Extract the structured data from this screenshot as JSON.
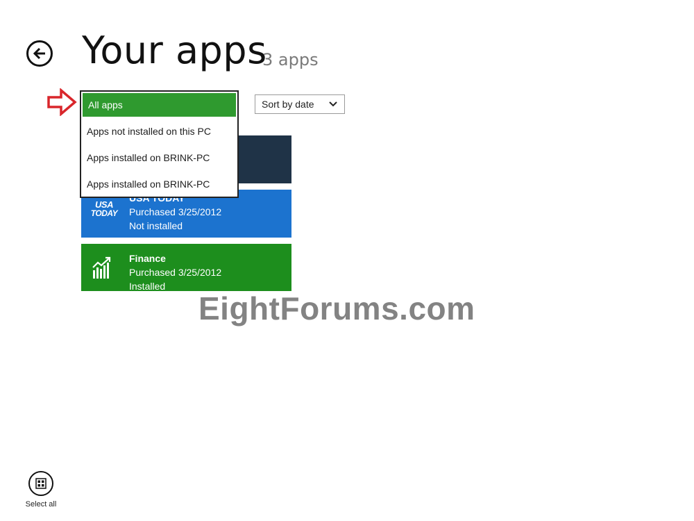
{
  "header": {
    "title": "Your apps",
    "count": "3 apps"
  },
  "filter": {
    "options": [
      {
        "label": "All apps",
        "selected": true
      },
      {
        "label": "Apps not installed on this PC",
        "selected": false
      },
      {
        "label": "Apps installed on BRINK-PC",
        "selected": false
      },
      {
        "label": "Apps installed on BRINK-PC",
        "selected": false
      }
    ]
  },
  "sort": {
    "value": "Sort by date"
  },
  "apps": [
    {
      "name": "",
      "status1": "",
      "status2": "",
      "color": "#1f3347"
    },
    {
      "name": "USA TODAY",
      "status1": "Purchased 3/25/2012",
      "status2": "Not installed",
      "color": "#1c73cf",
      "icon": "usa-today-logo"
    },
    {
      "name": "Finance",
      "status1": "Purchased 3/25/2012",
      "status2": "Installed",
      "color": "#1d8e1d",
      "icon": "finance-chart-icon"
    }
  ],
  "usa_logo": {
    "line1": "USA",
    "line2": "TODAY"
  },
  "watermark": "EightForums.com",
  "appbar": {
    "select_all_label": "Select all"
  },
  "colors": {
    "accent_green": "#2f9a2f",
    "arrow_red": "#d9262b"
  }
}
